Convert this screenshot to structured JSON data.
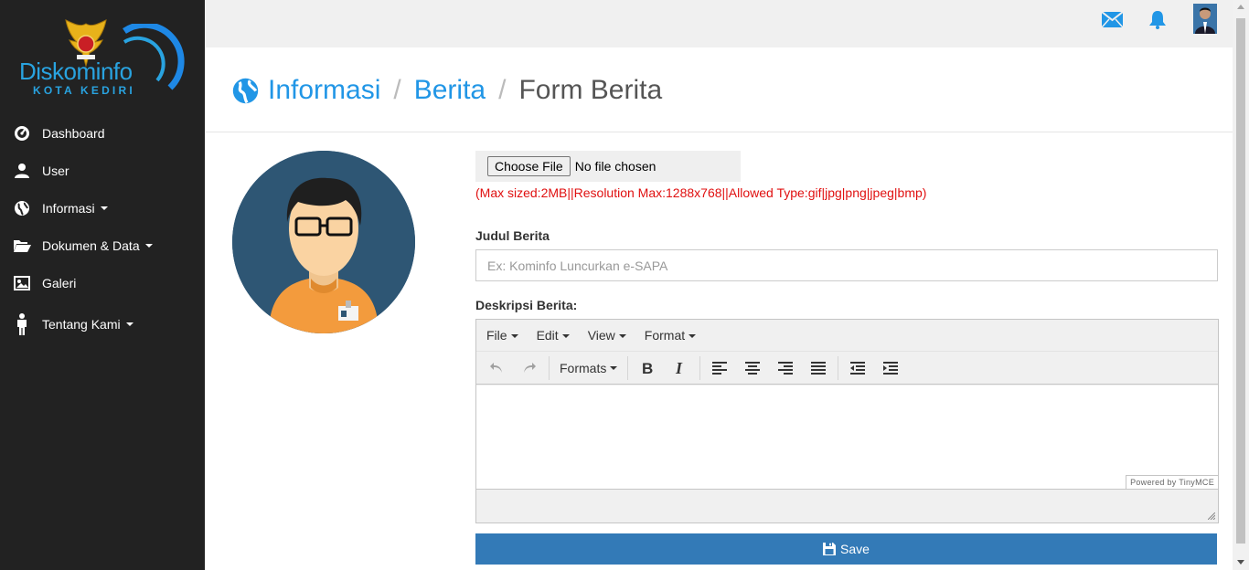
{
  "logo": {
    "name": "Diskominfo",
    "subtitle": "KOTA KEDIRI"
  },
  "sidebar": {
    "items": [
      {
        "label": "Dashboard",
        "icon": "dashboard-icon"
      },
      {
        "label": "User",
        "icon": "user-icon"
      },
      {
        "label": "Informasi",
        "icon": "globe-icon"
      },
      {
        "label": "Dokumen & Data",
        "icon": "folder-open-icon"
      },
      {
        "label": "Galeri",
        "icon": "picture-icon"
      },
      {
        "label": "Tentang Kami",
        "icon": "person-icon"
      }
    ]
  },
  "header": {
    "breadcrumb": [
      "Informasi",
      "Berita",
      "Form Berita"
    ]
  },
  "form": {
    "file_button": "Choose File",
    "file_status": "No file chosen",
    "file_note": "(Max sized:2MB||Resolution Max:1288x768||Allowed Type:gif|jpg|png|jpeg|bmp)",
    "judul_label": "Judul Berita",
    "judul_placeholder": "Ex: Kominfo Luncurkan e-SAPA",
    "deskripsi_label": "Deskripsi Berita:",
    "save_label": "Save"
  },
  "editor": {
    "menus": [
      "File",
      "Edit",
      "View",
      "Format"
    ],
    "formats_label": "Formats",
    "powered_by": "Powered by TinyMCE"
  },
  "colors": {
    "sidebar_bg": "#222222",
    "accent": "#2196e6",
    "button": "#337ab7",
    "note_red": "#e01010"
  }
}
